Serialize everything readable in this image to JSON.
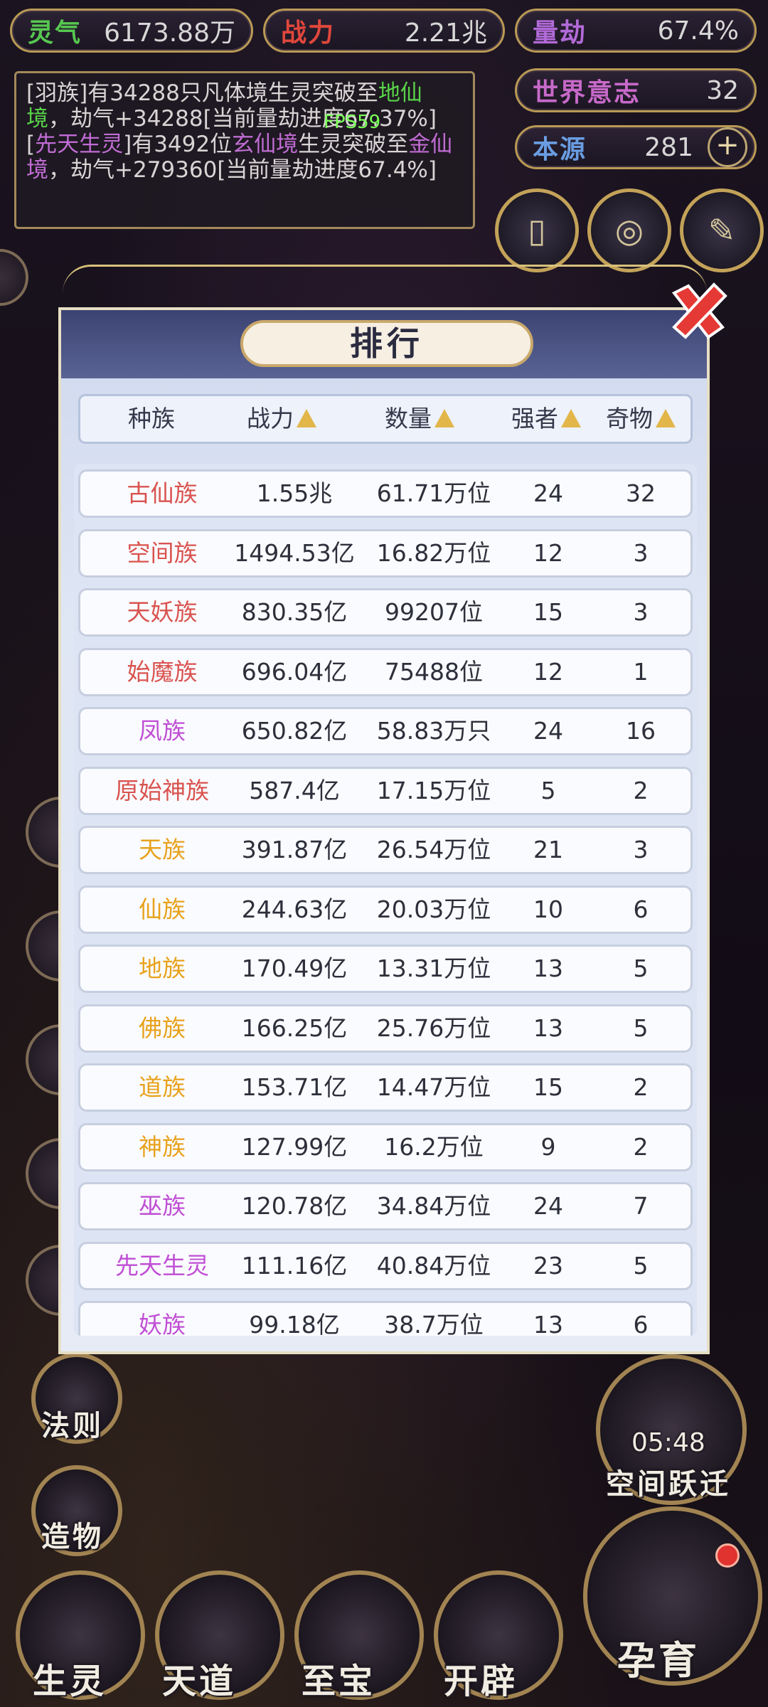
{
  "top_stats": [
    {
      "label": "灵气",
      "value": "6173.88万",
      "color": "#56c850"
    },
    {
      "label": "战力",
      "value": "2.21兆",
      "color": "#e0473c"
    },
    {
      "label": "量劫",
      "value": "67.4%",
      "color": "#b26ad8"
    },
    {
      "label": "世界意志",
      "value": "32",
      "color": "#c769c9"
    },
    {
      "label": "本源",
      "value": "281",
      "color": "#6a9de2"
    }
  ],
  "log": {
    "line1_prefix": "[羽族]有34288只凡体境生灵突破至",
    "line1_highlight": "地仙境",
    "line1_suffix": "，劫气+34288[当前量劫进度67.37%]",
    "line2_tag": "先天生灵",
    "line2_mid": "]有3492位",
    "line2_highlight1": "玄仙境",
    "line2_mid2": "生灵突破至",
    "line2_highlight2": "金仙境",
    "line2_suffix": "，劫气+279360[当前量劫进度67.4%]"
  },
  "fps": "FPS59",
  "ranking": {
    "title": "排行",
    "columns": [
      "种族",
      "战力",
      "数量",
      "强者",
      "奇物"
    ],
    "rows": [
      {
        "race": "古仙族",
        "power": "1.55兆",
        "count": "61.71万位",
        "strong": "24",
        "treasure": "32",
        "color": "#d9534f"
      },
      {
        "race": "空间族",
        "power": "1494.53亿",
        "count": "16.82万位",
        "strong": "12",
        "treasure": "3",
        "color": "#d9534f"
      },
      {
        "race": "天妖族",
        "power": "830.35亿",
        "count": "99207位",
        "strong": "15",
        "treasure": "3",
        "color": "#d9534f"
      },
      {
        "race": "始魔族",
        "power": "696.04亿",
        "count": "75488位",
        "strong": "12",
        "treasure": "1",
        "color": "#d9534f"
      },
      {
        "race": "凤族",
        "power": "650.82亿",
        "count": "58.83万只",
        "strong": "24",
        "treasure": "16",
        "color": "#c04fd4"
      },
      {
        "race": "原始神族",
        "power": "587.4亿",
        "count": "17.15万位",
        "strong": "5",
        "treasure": "2",
        "color": "#d9534f"
      },
      {
        "race": "天族",
        "power": "391.87亿",
        "count": "26.54万位",
        "strong": "21",
        "treasure": "3",
        "color": "#e8a21c"
      },
      {
        "race": "仙族",
        "power": "244.63亿",
        "count": "20.03万位",
        "strong": "10",
        "treasure": "6",
        "color": "#e8a21c"
      },
      {
        "race": "地族",
        "power": "170.49亿",
        "count": "13.31万位",
        "strong": "13",
        "treasure": "5",
        "color": "#e8a21c"
      },
      {
        "race": "佛族",
        "power": "166.25亿",
        "count": "25.76万位",
        "strong": "13",
        "treasure": "5",
        "color": "#e8a21c"
      },
      {
        "race": "道族",
        "power": "153.71亿",
        "count": "14.47万位",
        "strong": "15",
        "treasure": "2",
        "color": "#e8a21c"
      },
      {
        "race": "神族",
        "power": "127.99亿",
        "count": "16.2万位",
        "strong": "9",
        "treasure": "2",
        "color": "#e8a21c"
      },
      {
        "race": "巫族",
        "power": "120.78亿",
        "count": "34.84万位",
        "strong": "24",
        "treasure": "7",
        "color": "#c04fd4"
      },
      {
        "race": "先天生灵",
        "power": "111.16亿",
        "count": "40.84万位",
        "strong": "23",
        "treasure": "5",
        "color": "#c04fd4"
      },
      {
        "race": "妖族",
        "power": "99.18亿",
        "count": "38.7万位",
        "strong": "13",
        "treasure": "6",
        "color": "#c04fd4"
      }
    ]
  },
  "bottom_nav": [
    "生灵",
    "天道",
    "至宝",
    "开辟",
    "孕育"
  ],
  "side_labels": {
    "law": "法则",
    "create": "造物",
    "space_jump": "空间跃迁",
    "timer": "05:48"
  }
}
